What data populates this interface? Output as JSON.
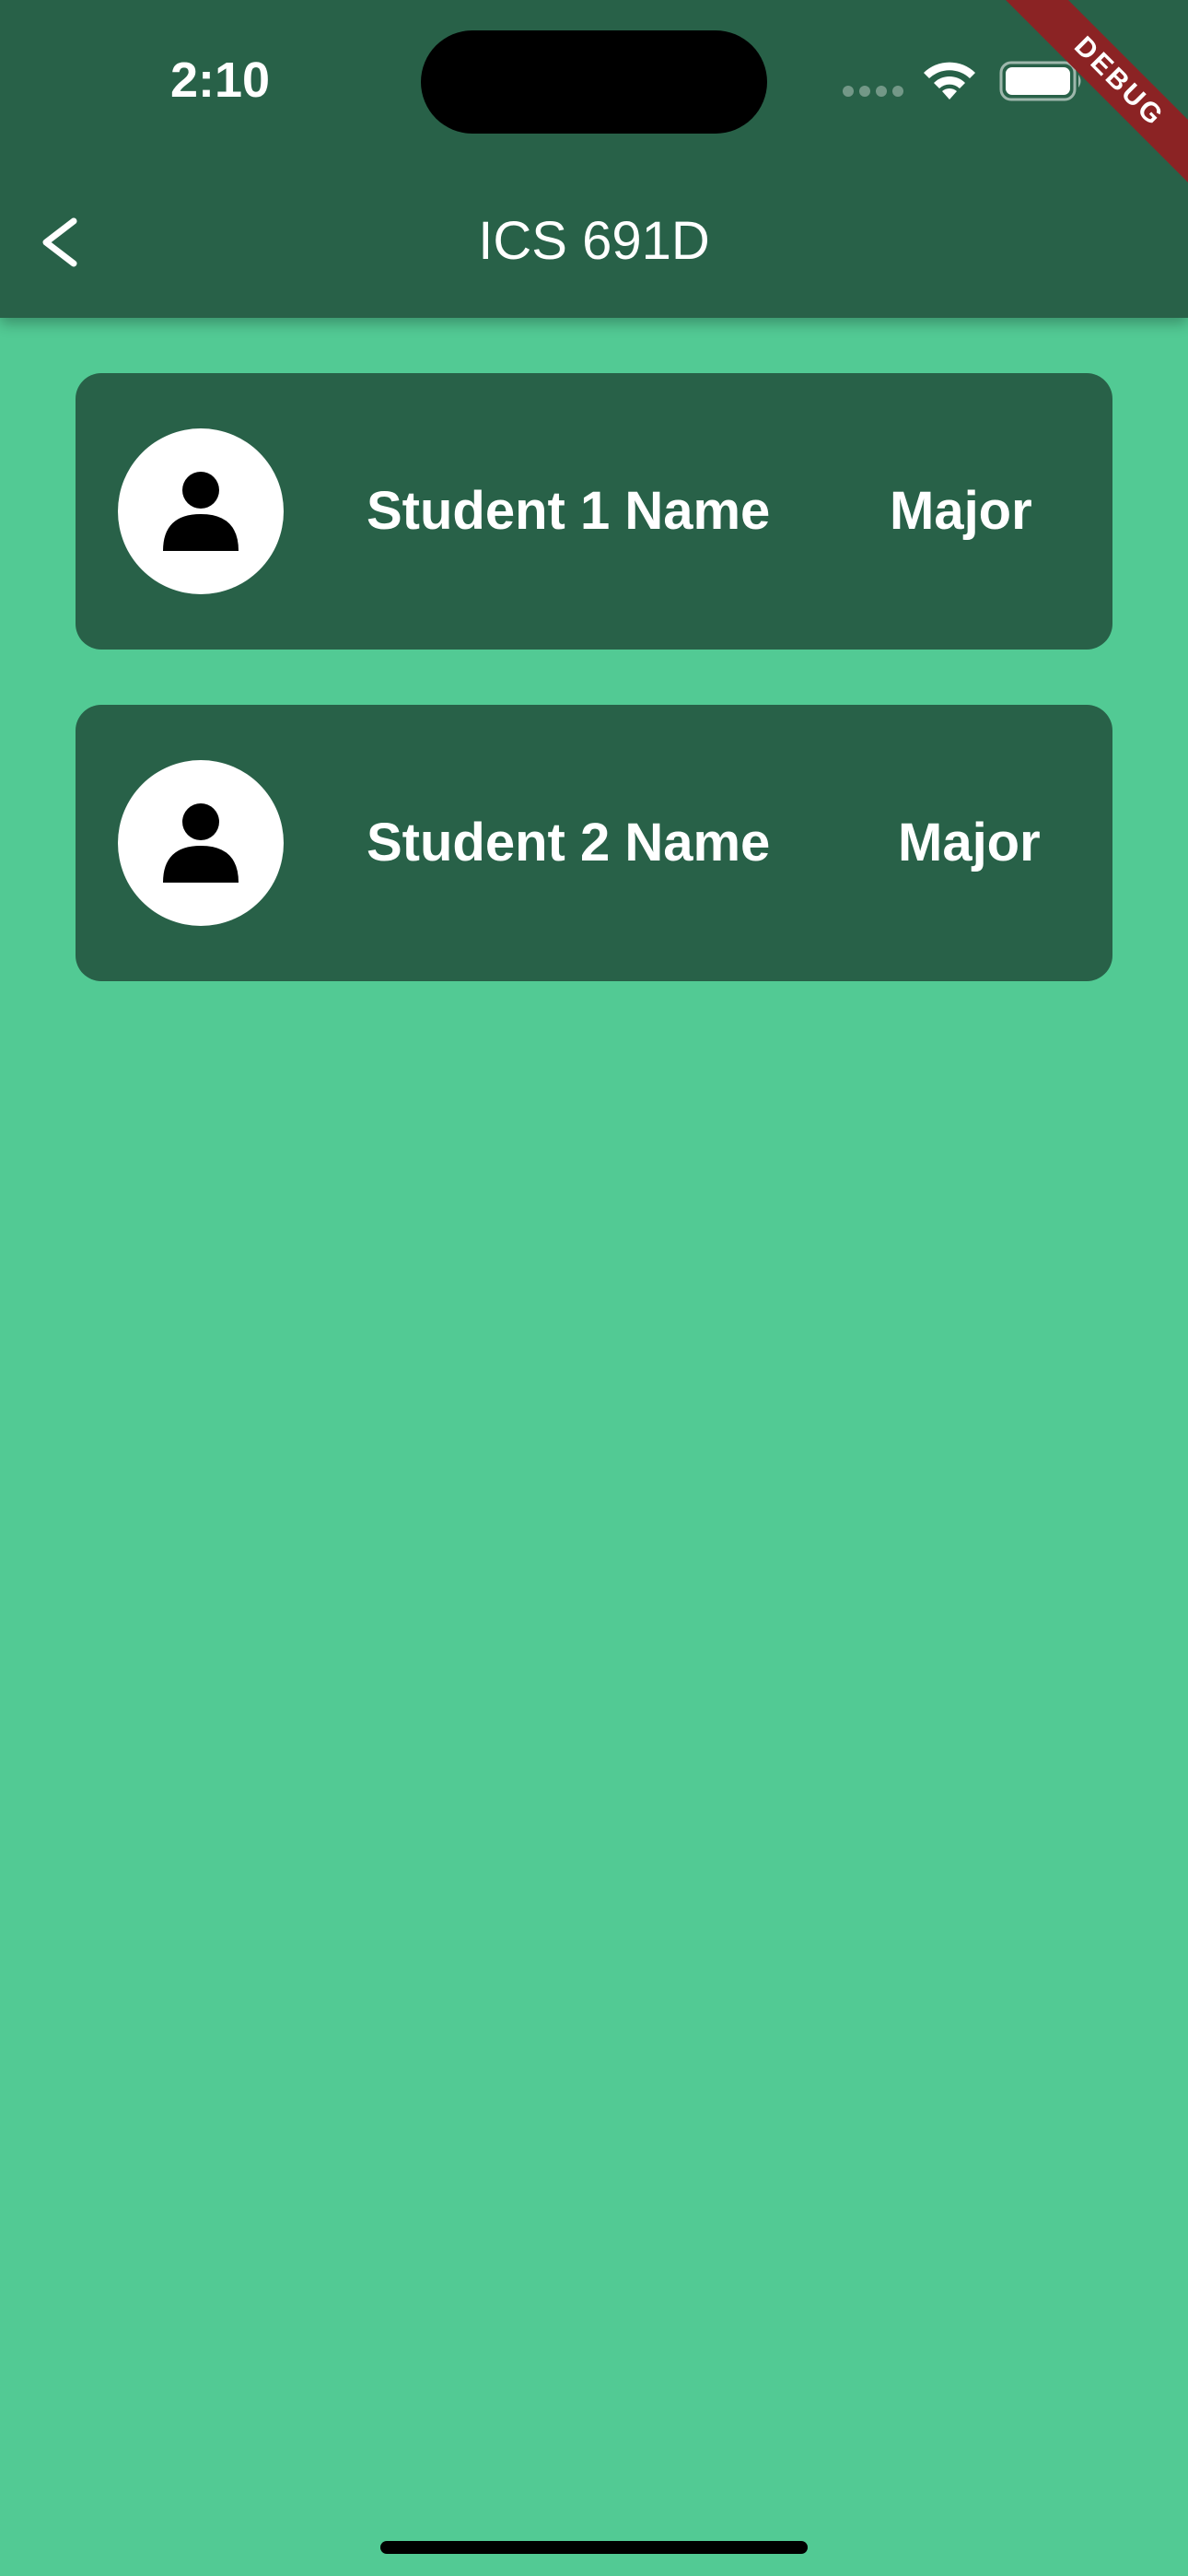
{
  "status_bar": {
    "time": "2:10",
    "wifi_icon": "wifi-icon",
    "battery_icon": "battery-full-icon",
    "cell_icon": "cell-signal-dots-icon"
  },
  "app_bar": {
    "title": "ICS 691D",
    "back_icon": "chevron-left-icon",
    "background": "#286148"
  },
  "debug_banner": {
    "label": "DEBUG",
    "color": "#8B2324"
  },
  "students": [
    {
      "name": "Student 1 Name",
      "major": "Major",
      "avatar_icon": "person-icon"
    },
    {
      "name": "Student 2 Name",
      "major": "Major",
      "avatar_icon": "person-icon"
    }
  ],
  "colors": {
    "page_background": "#52CA94",
    "card_background": "#286148",
    "text": "#FFFFFF"
  }
}
